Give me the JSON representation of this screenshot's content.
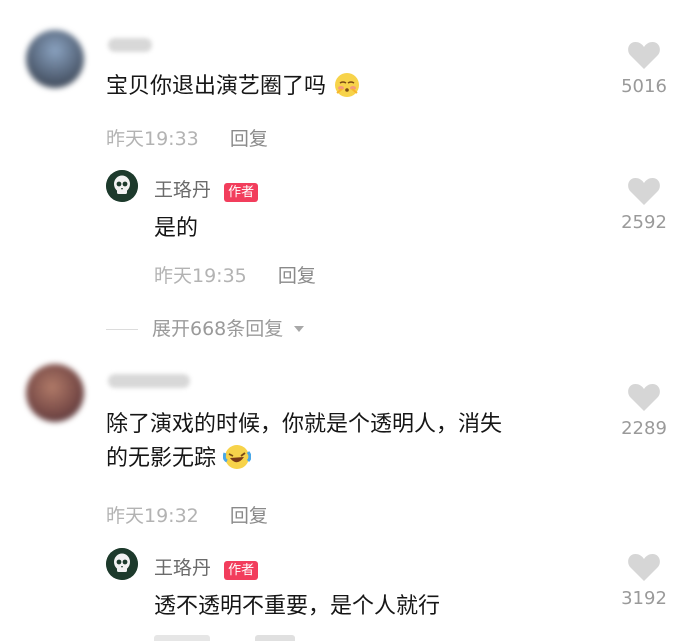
{
  "comments": [
    {
      "text": "宝贝你退出演艺圈了吗",
      "time": "昨天19:33",
      "reply_label": "回复",
      "likes": "5016",
      "replies": [
        {
          "author": "王珞丹",
          "badge": "作者",
          "text": "是的",
          "time": "昨天19:35",
          "reply_label": "回复",
          "likes": "2592"
        }
      ],
      "expand_label": "展开668条回复"
    },
    {
      "text_line1": "除了演戏的时候，你就是个透明人，消失",
      "text_line2": "的无影无踪",
      "time": "昨天19:32",
      "reply_label": "回复",
      "likes": "2289",
      "replies": [
        {
          "author": "王珞丹",
          "badge": "作者",
          "text": "透不透明不重要，是个人就行",
          "likes": "3192"
        }
      ]
    }
  ],
  "icons": {
    "like": "heart-icon",
    "expand": "caret-down-icon",
    "emoji1": "shy-face-emoji",
    "emoji2": "laughing-tears-emoji"
  },
  "colors": {
    "badge": "#f23d5c",
    "heart": "#d6d6d6"
  }
}
